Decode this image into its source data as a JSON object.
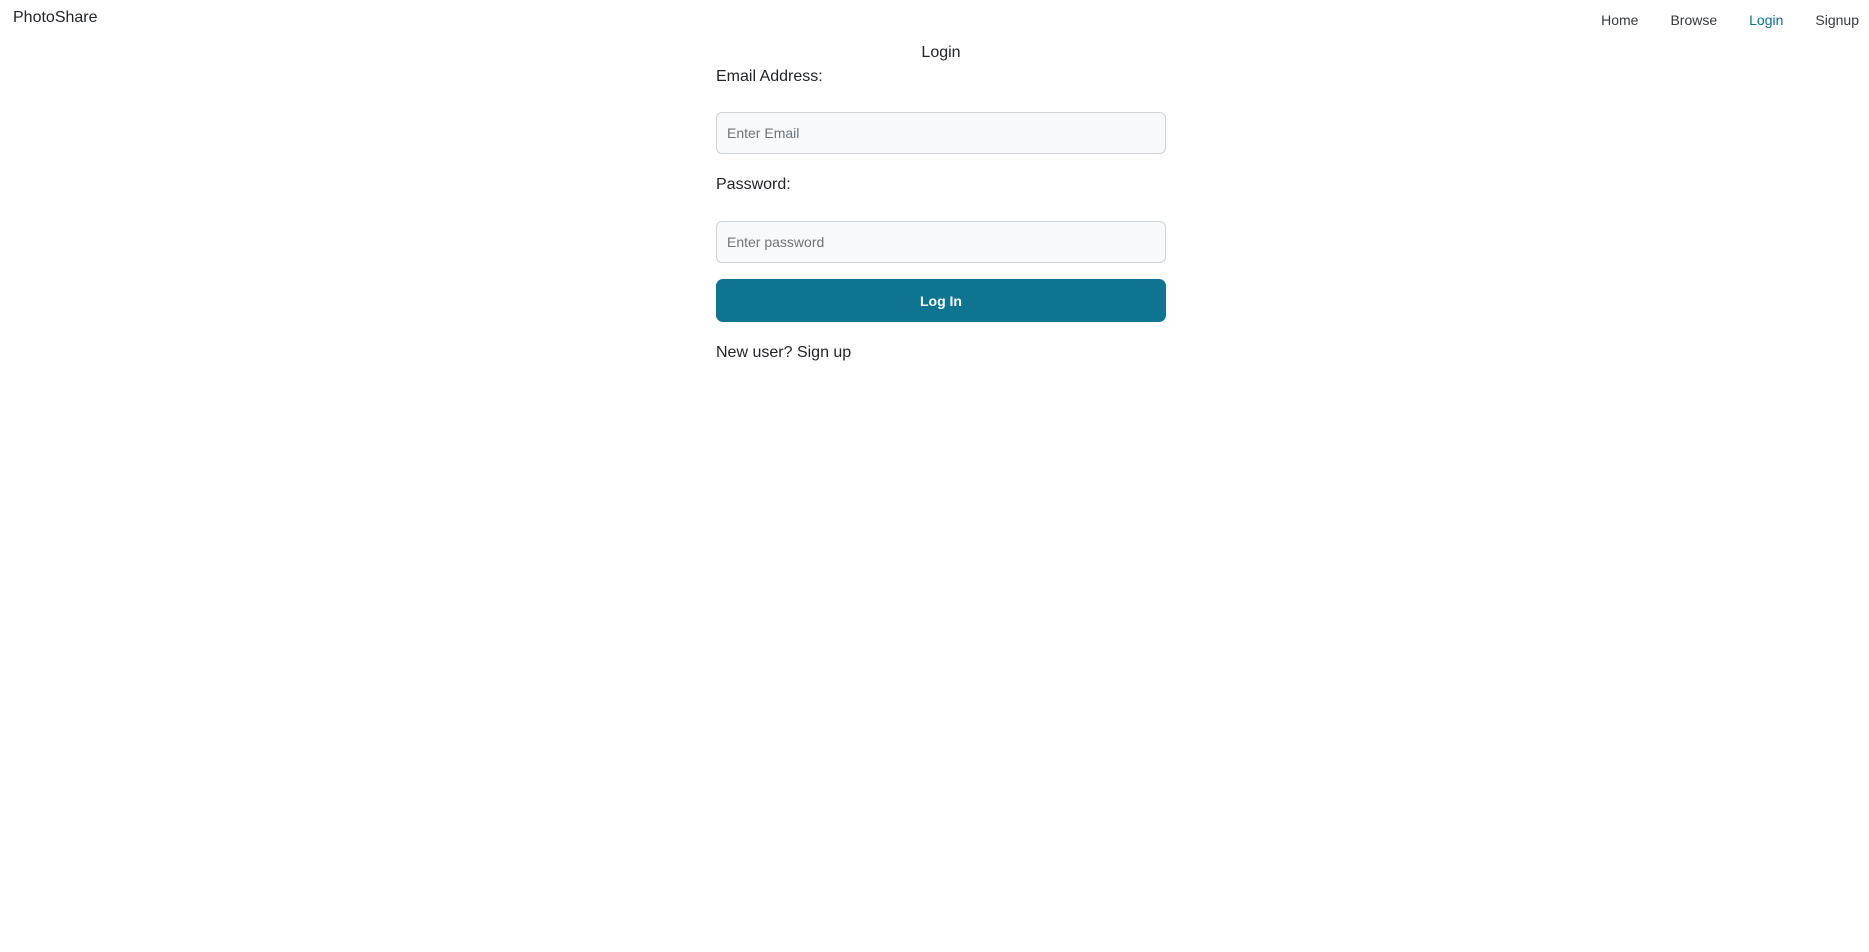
{
  "navbar": {
    "brand": "PhotoShare",
    "links": [
      {
        "label": "Home",
        "active": false
      },
      {
        "label": "Browse",
        "active": false
      },
      {
        "label": "Login",
        "active": true
      },
      {
        "label": "Signup",
        "active": false
      }
    ]
  },
  "login": {
    "title": "Login",
    "email_label": "Email Address:",
    "email_placeholder": "Enter Email",
    "email_value": "",
    "password_label": "Password:",
    "password_placeholder": "Enter password",
    "password_value": "",
    "submit_label": "Log In",
    "new_user_text": "New user?",
    "signup_link": "Sign up"
  },
  "colors": {
    "primary": "#0f7490",
    "active_link": "#0e6f8c",
    "input_bg": "#f8f9fa",
    "input_border": "#ced4da"
  }
}
